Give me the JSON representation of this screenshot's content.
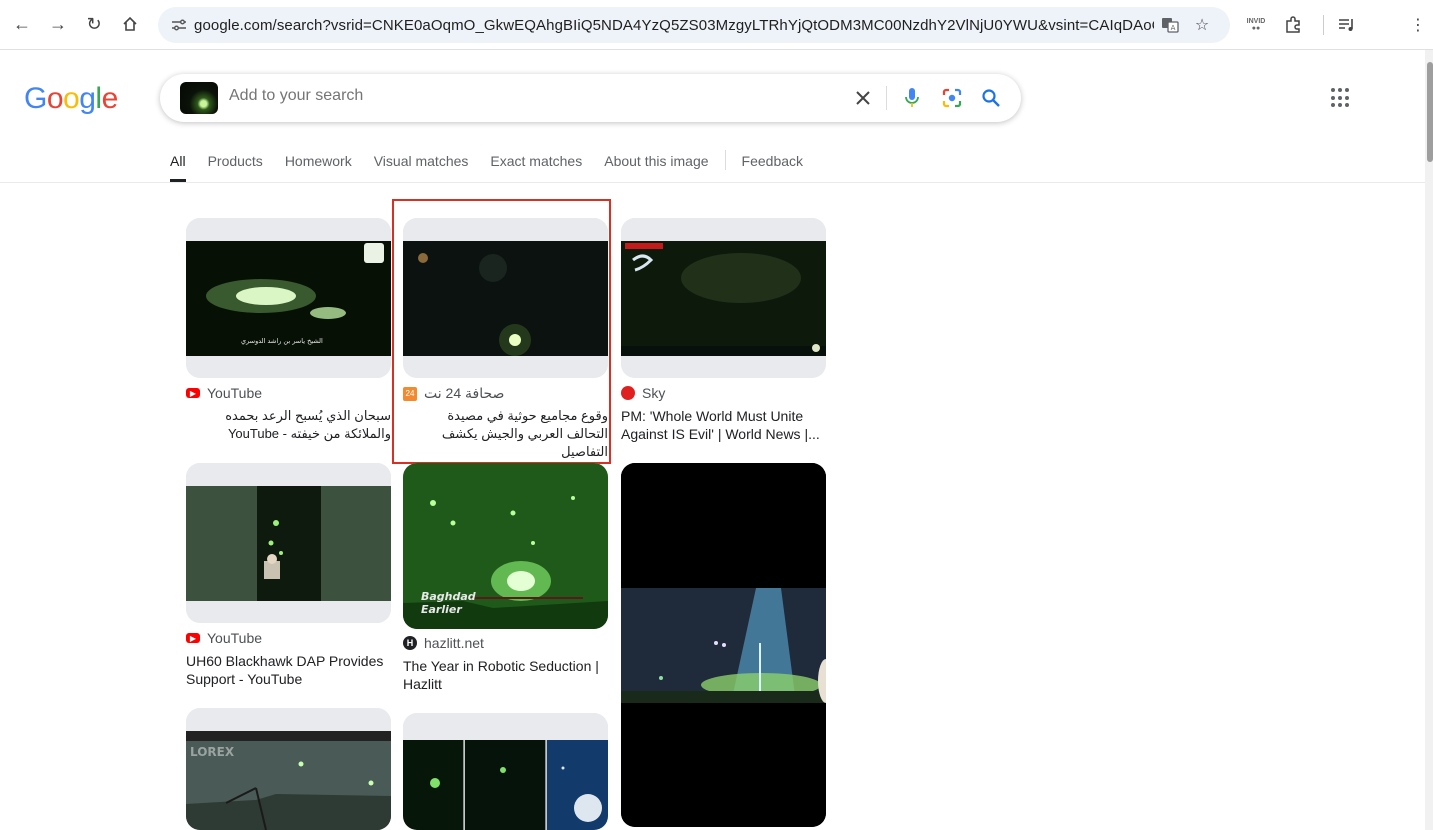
{
  "browser": {
    "url": "google.com/search?vsrid=CNKE0aOqmO_GkwEQAhgBIiQ5NDA4YzQ5ZS03MzgyLTRhYjQtODM3MC00NzdhY2VlNjU0YWU&vsint=CAIqDAoCCAcSAggKGA...",
    "ext_invid": "INVID"
  },
  "header": {
    "logo": "Google",
    "search_placeholder": "Add to your search"
  },
  "tabs": [
    "All",
    "Products",
    "Homework",
    "Visual matches",
    "Exact matches",
    "About this image",
    "Feedback"
  ],
  "results": [
    {
      "source": "YouTube",
      "title": "سبحان الذي يُسبح الرعد بحمده والملائكة من خيفته - YouTube",
      "favicon_color": "#ff0000"
    },
    {
      "source": "صحافة 24 نت",
      "title": "وقوع مجاميع حوثية في مصيدة التحالف العربي والجيش يكشف التفاصيل",
      "favicon_color": "#f28b30"
    },
    {
      "source": "Sky",
      "title": "PM: 'Whole World Must Unite Against IS Evil' | World News |...",
      "favicon_color": "#e02020"
    },
    {
      "source": "YouTube",
      "title": "UH60 Blackhawk DAP Provides Support - YouTube",
      "favicon_color": "#ff0000"
    },
    {
      "source": "hazlitt.net",
      "title": "The Year in Robotic Seduction | Hazlitt",
      "favicon_color": "#202124"
    },
    {
      "image_text": "LOREX"
    }
  ],
  "image_overlays": {
    "r1_caption": "الشيخ ياسر بن راشد الدوسري",
    "r5_caption": "Baghdad Earlier"
  }
}
